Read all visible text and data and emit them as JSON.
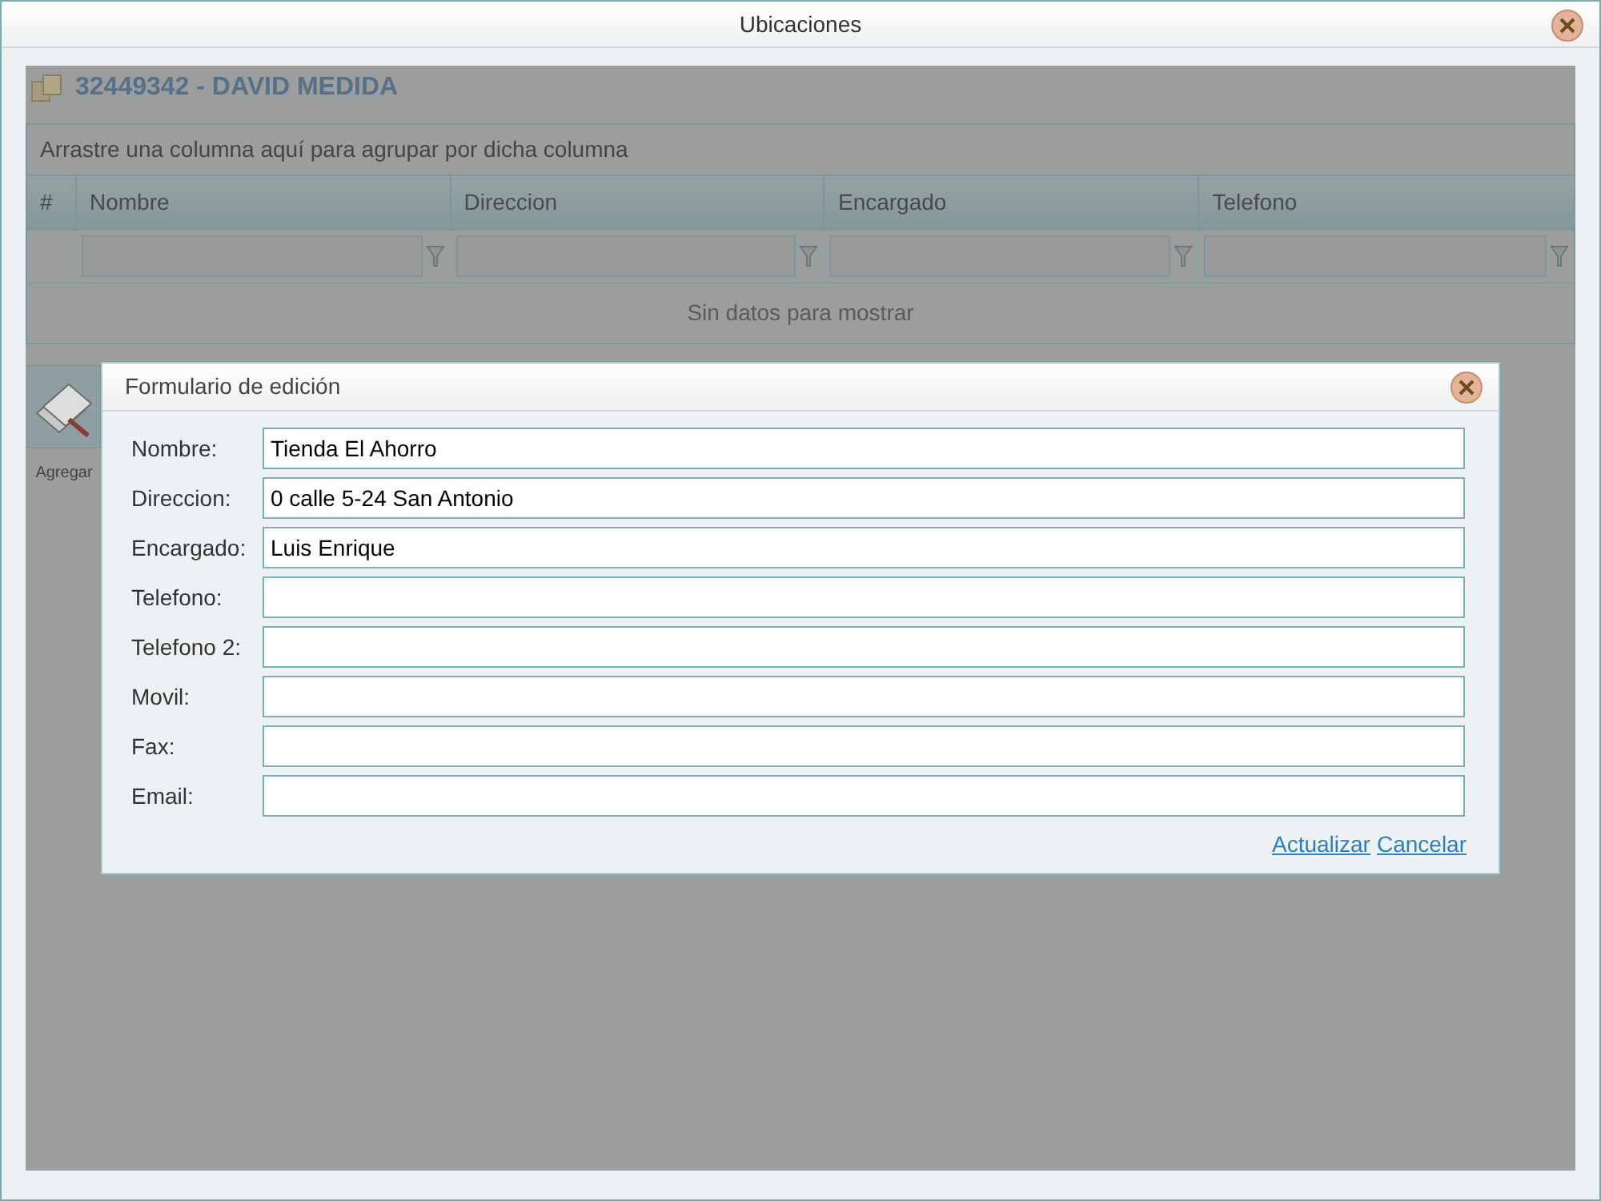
{
  "window": {
    "title": "Ubicaciones"
  },
  "record_title": "32449342 - DAVID MEDIDA",
  "group_panel": "Arrastre una columna aquí para agrupar por dicha columna",
  "table": {
    "columns": [
      "#",
      "Nombre",
      "Direccion",
      "Encargado",
      "Telefono"
    ],
    "empty_text": "Sin datos para mostrar"
  },
  "toolbar": [
    {
      "label": "Agregar"
    }
  ],
  "dialog": {
    "title": "Formulario de edición",
    "fields": [
      {
        "label": "Nombre:",
        "value": "Tienda El Ahorro"
      },
      {
        "label": "Direccion:",
        "value": "0 calle 5-24 San Antonio"
      },
      {
        "label": "Encargado:",
        "value": "Luis Enrique"
      },
      {
        "label": "Telefono:"
      },
      {
        "label": "Telefono 2:"
      },
      {
        "label": "Movil:"
      },
      {
        "label": "Fax:"
      },
      {
        "label": "Email:"
      }
    ],
    "links": [
      "Actualizar",
      "Cancelar"
    ]
  }
}
